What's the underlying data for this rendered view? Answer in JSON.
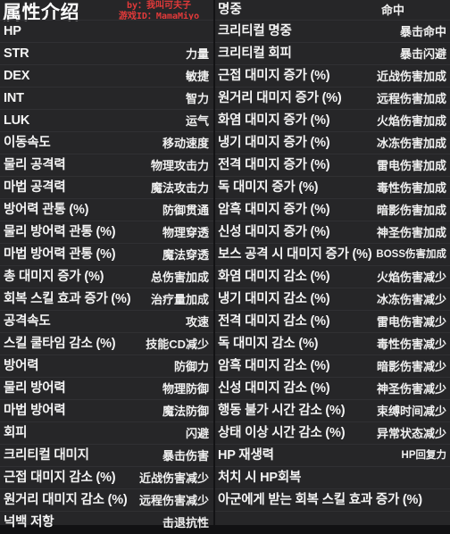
{
  "meta": {
    "title": "属性介绍",
    "credit_line1": "by：我叫可夫子",
    "credit_line2": "游戏ID：MamaMiyo",
    "accent_red": "#e33a3a",
    "background": "#262628",
    "text_color": "#f4f4f4",
    "divider_color": "#303033"
  },
  "header": {
    "left_title": "属性介绍",
    "right_kr": "명중",
    "right_cn": "命中"
  },
  "left_column": [
    {
      "kr": "HP",
      "cn": ""
    },
    {
      "kr": "STR",
      "cn": "力量"
    },
    {
      "kr": "DEX",
      "cn": "敏捷"
    },
    {
      "kr": "INT",
      "cn": "智力"
    },
    {
      "kr": "LUK",
      "cn": "运气"
    },
    {
      "kr": "이동속도",
      "cn": "移动速度"
    },
    {
      "kr": "물리 공격력",
      "cn": "物理攻击力"
    },
    {
      "kr": "마법 공격력",
      "cn": "魔法攻击力"
    },
    {
      "kr": "방어력 관통 (%)",
      "cn": "防御贯通"
    },
    {
      "kr": "물리 방어력 관통 (%)",
      "cn": "物理穿透"
    },
    {
      "kr": "마법 방어력 관통 (%)",
      "cn": "魔法穿透"
    },
    {
      "kr": "총 대미지 증가 (%)",
      "cn": "总伤害加成"
    },
    {
      "kr": "회복 스킬 효과 증가 (%)",
      "cn": "治疗量加成"
    },
    {
      "kr": "공격속도",
      "cn": "攻速"
    },
    {
      "kr": "스킬 쿨타임 감소 (%)",
      "cn": "技能CD减少"
    },
    {
      "kr": "방어력",
      "cn": "防御力"
    },
    {
      "kr": "물리 방어력",
      "cn": "物理防御"
    },
    {
      "kr": "마법 방어력",
      "cn": "魔法防御"
    },
    {
      "kr": "회피",
      "cn": "闪避"
    },
    {
      "kr": "크리티컬 대미지",
      "cn": "暴击伤害"
    },
    {
      "kr": "근접 대미지 감소 (%)",
      "cn": "近战伤害减少"
    },
    {
      "kr": "원거리 대미지 감소 (%)",
      "cn": "远程伤害减少"
    },
    {
      "kr": "넉백 저항",
      "cn": "击退抗性"
    }
  ],
  "right_column": [
    {
      "kr": "크리티컬 명중",
      "cn": "暴击命中"
    },
    {
      "kr": "크리티컬 회피",
      "cn": "暴击闪避"
    },
    {
      "kr": "근접 대미지 증가 (%)",
      "cn": "近战伤害加成"
    },
    {
      "kr": "원거리 대미지 증가 (%)",
      "cn": "远程伤害加成"
    },
    {
      "kr": "화염 대미지 증가 (%)",
      "cn": "火焰伤害加成"
    },
    {
      "kr": "냉기 대미지 증가 (%)",
      "cn": "冰冻伤害加成"
    },
    {
      "kr": "전격 대미지 증가 (%)",
      "cn": "雷电伤害加成"
    },
    {
      "kr": "독 대미지 증가 (%)",
      "cn": "毒性伤害加成"
    },
    {
      "kr": "암흑 대미지 증가 (%)",
      "cn": "暗影伤害加成"
    },
    {
      "kr": "신성 대미지 증가 (%)",
      "cn": "神圣伤害加成"
    },
    {
      "kr": "보스 공격 시 대미지 증가 (%)",
      "cn": "BOSS伤害加成",
      "small": true
    },
    {
      "kr": "화염 대미지 감소 (%)",
      "cn": "火焰伤害减少"
    },
    {
      "kr": "냉기 대미지 감소 (%)",
      "cn": "冰冻伤害减少"
    },
    {
      "kr": "전격 대미지 감소 (%)",
      "cn": "雷电伤害减少"
    },
    {
      "kr": "독 대미지 감소 (%)",
      "cn": "毒性伤害减少"
    },
    {
      "kr": "암흑 대미지 감소 (%)",
      "cn": "暗影伤害减少"
    },
    {
      "kr": "신성 대미지 감소 (%)",
      "cn": "神圣伤害减少"
    },
    {
      "kr": "행동 불가 시간 감소 (%)",
      "cn": "束缚时间减少"
    },
    {
      "kr": "상태 이상 시간 감소 (%)",
      "cn": "异常状态减少"
    },
    {
      "kr": "HP 재생력",
      "cn": "HP回复力",
      "small": true
    },
    {
      "kr": "처치 시 HP회복",
      "cn": ""
    },
    {
      "kr": "아군에게 받는 회복 스킬 효과 증가 (%)",
      "cn": "",
      "wide": true
    },
    {
      "kr": "",
      "cn": ""
    }
  ]
}
